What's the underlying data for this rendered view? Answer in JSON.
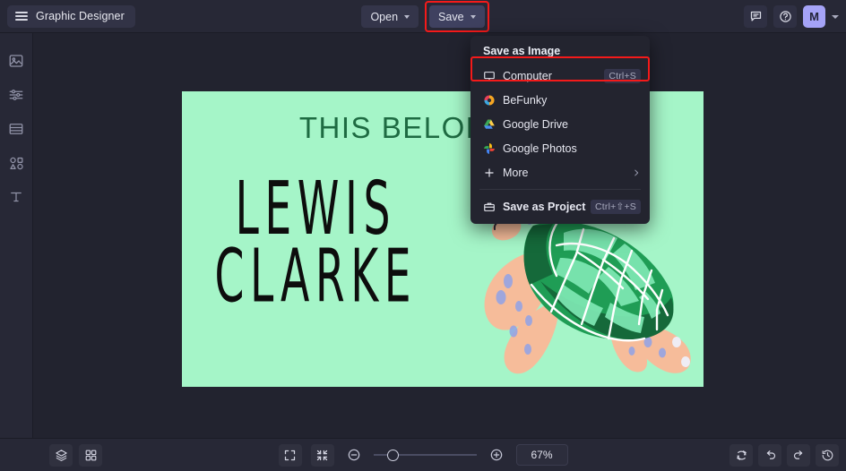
{
  "app": {
    "name": "Graphic Designer",
    "menu_icon": "hamburger-icon",
    "bg_color": "#22232f",
    "panel_color": "#272836",
    "accent_color": "#a5a3f7",
    "highlight_color": "#f41a1a"
  },
  "topbar": {
    "open_label": "Open",
    "save_label": "Save",
    "feedback_icon": "chat-icon",
    "help_icon": "help-circle-icon",
    "avatar_initial": "M",
    "avatar_chevron_icon": "chevron-down-icon"
  },
  "rail": {
    "items": [
      {
        "icon": "image-icon",
        "name": "sidebar-item-image"
      },
      {
        "icon": "sliders-icon",
        "name": "sidebar-item-adjust"
      },
      {
        "icon": "layers-panel-icon",
        "name": "sidebar-item-templates"
      },
      {
        "icon": "shapes-icon",
        "name": "sidebar-item-graphics"
      },
      {
        "icon": "text-icon",
        "name": "sidebar-item-text"
      }
    ]
  },
  "save_menu": {
    "header": "Save as Image",
    "items": [
      {
        "label": "Computer",
        "shortcut": "Ctrl+S",
        "icon": "monitor-icon",
        "highlighted": true
      },
      {
        "label": "BeFunky",
        "shortcut": "",
        "icon": "befunky-logo-icon",
        "highlighted": false
      },
      {
        "label": "Google Drive",
        "shortcut": "",
        "icon": "google-drive-icon",
        "highlighted": false
      },
      {
        "label": "Google Photos",
        "shortcut": "",
        "icon": "google-photos-icon",
        "highlighted": false
      },
      {
        "label": "More",
        "shortcut": "",
        "icon": "plus-icon",
        "highlighted": false,
        "submenu_icon": "chevron-right-icon"
      }
    ],
    "project": {
      "label": "Save as Project",
      "shortcut": "Ctrl+⇧+S",
      "icon": "briefcase-icon"
    }
  },
  "canvas": {
    "background_color": "#A5F5C8",
    "title_text": "THIS BELONGS TO",
    "title_color": "#1e6b42",
    "name_line1": "LEWIS",
    "name_line2": "CLARKE",
    "name_color": "#0d0d0d",
    "artwork": "sea-turtle-illustration",
    "artwork_shell_color": "#1f9d55",
    "artwork_flipper_color": "#f6bc9a"
  },
  "bottombar": {
    "layers_icon": "layers-icon",
    "grid_icon": "grid-icon",
    "fit_screen_icon": "fit-screen-icon",
    "actual_size_icon": "collapse-arrows-icon",
    "zoom_out_icon": "minus-circle-icon",
    "zoom_in_icon": "plus-circle-icon",
    "zoom_value": "67%",
    "zoom_slider_percent": 15,
    "reset_icon": "reset-icon",
    "undo_icon": "undo-icon",
    "redo_icon": "redo-icon",
    "history_icon": "history-icon"
  }
}
